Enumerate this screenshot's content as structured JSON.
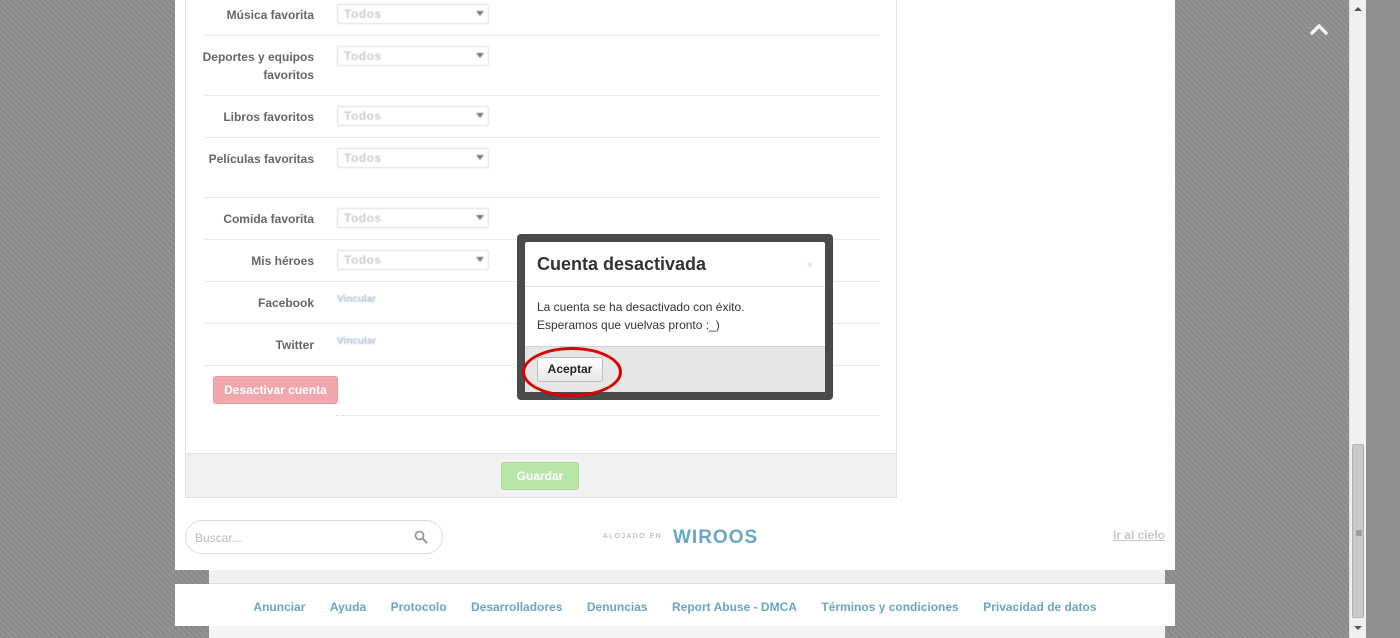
{
  "form": {
    "select_placeholder": "Todos",
    "link_placeholder": "Vincular",
    "rows": [
      {
        "label": "Música favorita"
      },
      {
        "label": "Deportes y equipos favoritos"
      },
      {
        "label": "Libros favoritos"
      },
      {
        "label": "Películas favoritas"
      },
      {
        "label": "Comida favorita"
      },
      {
        "label": "Mis héroes"
      },
      {
        "label": "Facebook"
      },
      {
        "label": "Twitter"
      }
    ],
    "deactivate_label": "Desactivar cuenta",
    "save_label": "Guardar"
  },
  "footer": {
    "search_placeholder": "Buscar...",
    "hosted_small": "ALOJADO EN",
    "hosted_brand": "WIROOS",
    "go_top": "Ir al cielo"
  },
  "bottom_nav": {
    "links": [
      "Anunciar",
      "Ayuda",
      "Protocolo",
      "Desarrolladores",
      "Denuncias",
      "Report Abuse - DMCA",
      "Términos y condiciones",
      "Privacidad de datos"
    ]
  },
  "modal": {
    "title": "Cuenta desactivada",
    "close_glyph": "×",
    "line1": "La cuenta se ha desactivado con éxito.",
    "line2": "Esperamos que vuelvas pronto :_)",
    "accept_label": "Aceptar"
  },
  "colors": {
    "link_blue": "#6aa5c5",
    "deactivate_pink": "#f1a8ad",
    "save_green": "#b7e6a8",
    "highlight_red": "#d90000"
  }
}
